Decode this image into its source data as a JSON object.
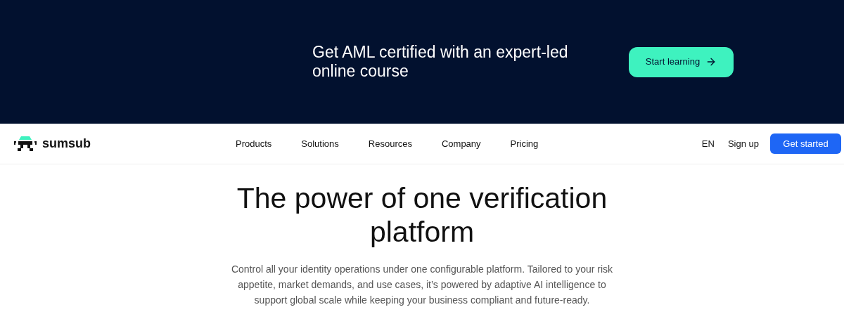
{
  "banner": {
    "text": "Get AML certified with an expert-led online course",
    "button": "Start learning"
  },
  "nav": {
    "logo": "sumsub",
    "items": [
      "Products",
      "Solutions",
      "Resources",
      "Company",
      "Pricing"
    ],
    "language": "EN",
    "signup": "Sign up",
    "cta": "Get started"
  },
  "hero": {
    "title": "The power of one verification platform",
    "subtitle": "Control all your identity operations under one configurable platform. Tailored to your risk appetite, market demands, and use cases, it’s powered by adaptive AI intelligence to support global scale while keeping your business compliant and future-ready."
  }
}
